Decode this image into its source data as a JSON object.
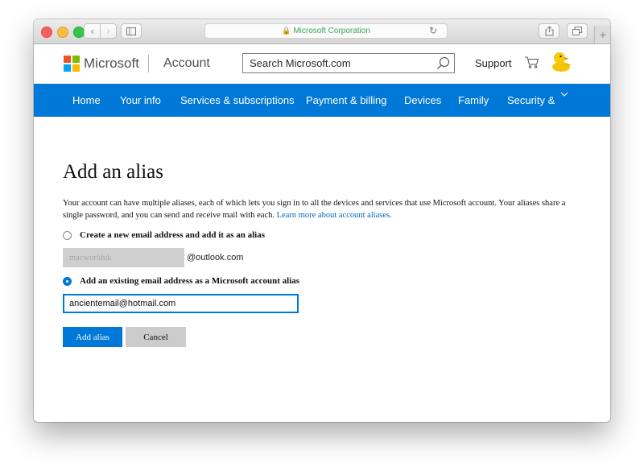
{
  "browser": {
    "address_text": "Microsoft Corporation",
    "back_glyph": "‹",
    "forward_glyph": "›",
    "plus_glyph": "+",
    "reload_glyph": "↻",
    "lock_glyph": "🔒"
  },
  "header": {
    "brand": "Microsoft",
    "section": "Account",
    "search_placeholder": "Search Microsoft.com",
    "support_label": "Support",
    "icons": [
      "microsoft-logo",
      "search-icon",
      "cart-icon",
      "avatar-duck"
    ]
  },
  "nav": {
    "items": [
      {
        "label": "Home"
      },
      {
        "label": "Your info"
      },
      {
        "label": "Services & subscriptions"
      },
      {
        "label": "Payment & billing"
      },
      {
        "label": "Devices"
      },
      {
        "label": "Family"
      },
      {
        "label": "Security & p"
      }
    ]
  },
  "main": {
    "title": "Add an alias",
    "intro_text": "Your account can have multiple aliases, each of which lets you sign in to all the devices and services that use Microsoft account. Your aliases share a single password, and you can send and receive mail with each. ",
    "learn_more_link": "Learn more about account aliases.",
    "option_new": {
      "label": "Create a new email address and add it as an alias",
      "selected": false,
      "placeholder": "macworlduk",
      "domain": "@outlook.com"
    },
    "option_existing": {
      "label": "Add an existing email address as a Microsoft account alias",
      "selected": true,
      "value": "ancientemail@hotmail.com"
    },
    "add_button": "Add alias",
    "cancel_button": "Cancel"
  },
  "colors": {
    "accent": "#0078d7",
    "link": "#0067b8",
    "address_text": "#3aa55a"
  }
}
